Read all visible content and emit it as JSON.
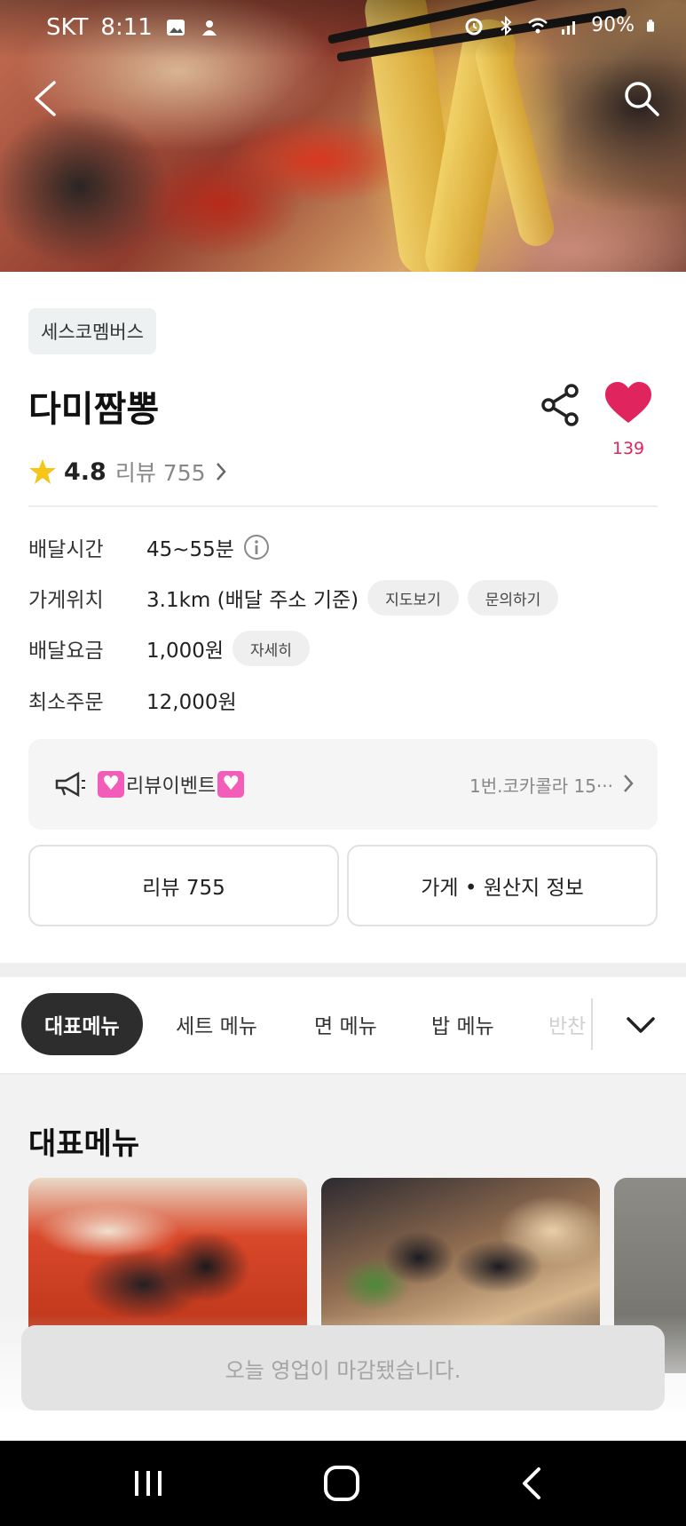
{
  "status_bar": {
    "carrier": "SKT",
    "time": "8:11",
    "battery": "90%",
    "icons": [
      "gallery-icon",
      "notification-icon",
      "alarm-icon",
      "bluetooth-icon",
      "wifi-icon",
      "signal-icon",
      "battery-icon"
    ]
  },
  "header": {
    "back_icon": "back-arrow-icon",
    "search_icon": "search-icon"
  },
  "store": {
    "tag": "세스코멤버스",
    "name": "다미짬뽕",
    "rating": "4.8",
    "review_link": "리뷰 755",
    "like_count": "139",
    "like_color": "#e0245e"
  },
  "info": {
    "delivery_time_label": "배달시간",
    "delivery_time_value": "45~55분",
    "location_label": "가게위치",
    "location_value": "3.1km (배달 주소 기준)",
    "map_button": "지도보기",
    "inquiry_button": "문의하기",
    "fee_label": "배달요금",
    "fee_value": "1,000원",
    "fee_detail_button": "자세히",
    "min_order_label": "최소주문",
    "min_order_value": "12,000원"
  },
  "notice": {
    "title": "리뷰이벤트",
    "preview": "1번.코카콜라 15···"
  },
  "actions": {
    "review_button": "리뷰 755",
    "store_info_button": "가게 • 원산지 정보"
  },
  "menu_tabs": {
    "items": [
      "대표메뉴",
      "세트 메뉴",
      "면 메뉴",
      "밥 메뉴",
      "반찬"
    ],
    "active": "대표메뉴"
  },
  "menu_section": {
    "title": "대표메뉴"
  },
  "footer": {
    "closed_message": "오늘 영업이 마감됐습니다."
  },
  "colors": {
    "accent_pink": "#e0245e",
    "active_tab_bg": "#2d2d2d"
  }
}
